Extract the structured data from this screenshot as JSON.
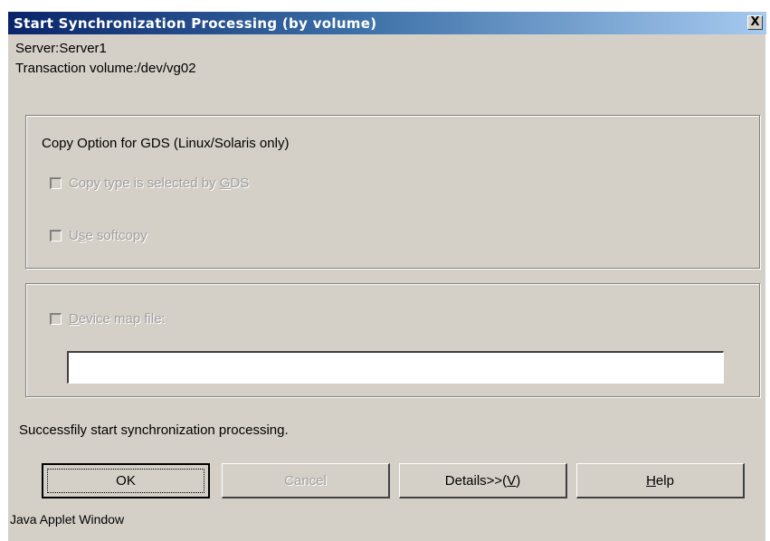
{
  "window": {
    "title": "Start Synchronization Processing (by volume)",
    "close_label": "X"
  },
  "info": {
    "server": "Server:Server1",
    "transaction_volume": "Transaction volume:/dev/vg02"
  },
  "copy_option_group": {
    "title": "Copy Option for GDS (Linux/Solaris only)",
    "copy_type_checkbox": {
      "label_before": "Copy type is selected by ",
      "label_mnemonic": "G",
      "label_after": "DS",
      "checked": false,
      "enabled": false
    },
    "softcopy_checkbox": {
      "label_before": "U",
      "label_mnemonic": "s",
      "label_after": "e softcopy",
      "checked": false,
      "enabled": false
    }
  },
  "device_map_group": {
    "checkbox": {
      "label_mnemonic": "D",
      "label_after": "evice map file:",
      "checked": false,
      "enabled": false
    },
    "file_input_value": ""
  },
  "status_message": "Successfily start synchronization processing.",
  "buttons": {
    "ok": "OK",
    "cancel": "Cancel",
    "details_before": "Details>>(",
    "details_mnemonic": "V",
    "details_after": ")",
    "help_mnemonic": "H",
    "help_after": "elp"
  },
  "footer": {
    "applet_label": "Java Applet Window"
  }
}
